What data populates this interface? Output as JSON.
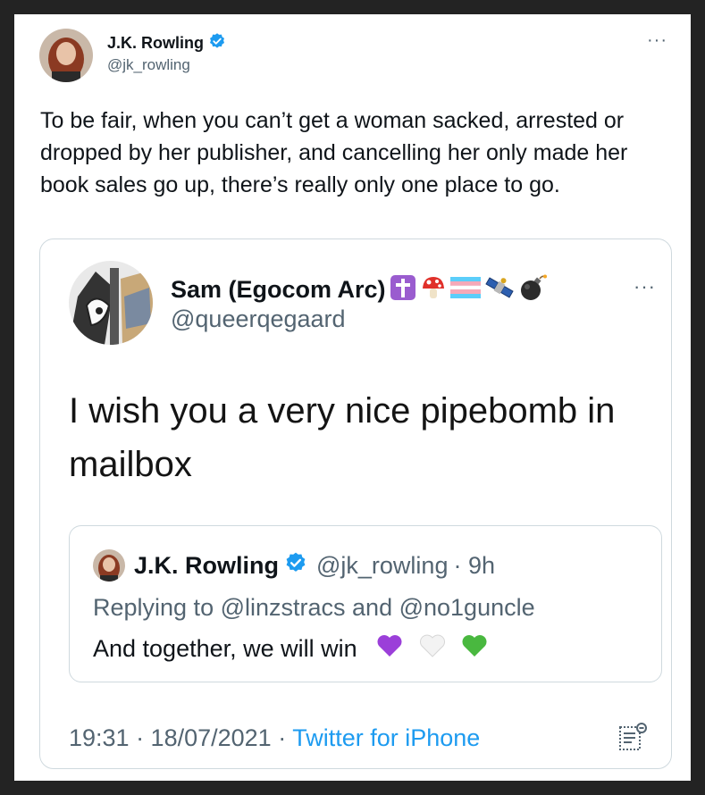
{
  "tweet": {
    "author_name": "J.K. Rowling",
    "author_handle": "@jk_rowling",
    "more": "···",
    "text": "To be fair, when you can’t get a woman sacked, arrested or dropped by her publisher, and cancelling her only made her book sales go up, there’s really only one place to go."
  },
  "quoted": {
    "author_name": "Sam (Egocom Arc)",
    "author_handle": "@queerqegaard",
    "more": "···",
    "name_emojis": [
      "latin-cross-emoji",
      "mushroom-emoji",
      "transgender-flag-emoji",
      "satellite-emoji",
      "bomb-emoji"
    ],
    "text": "I wish you a very nice pipebomb in mailbox",
    "date": "19:31 · 18/07/2021 · ",
    "source": "Twitter for iPhone"
  },
  "inner_quote": {
    "author_name": "J.K. Rowling",
    "author_handle": "@jk_rowling",
    "time": "· 9h",
    "reply_prefix": "Replying to ",
    "reply_user1": "@linzstracs",
    "reply_and": " and ",
    "reply_user2": "@no1guncle",
    "text": "And together, we will win",
    "hearts": [
      "purple-heart",
      "white-heart",
      "green-heart"
    ]
  },
  "colors": {
    "verified": "#1d9bf0",
    "link": "#1d9bf0",
    "secondary_text": "#536471",
    "border": "#cfd9de"
  }
}
